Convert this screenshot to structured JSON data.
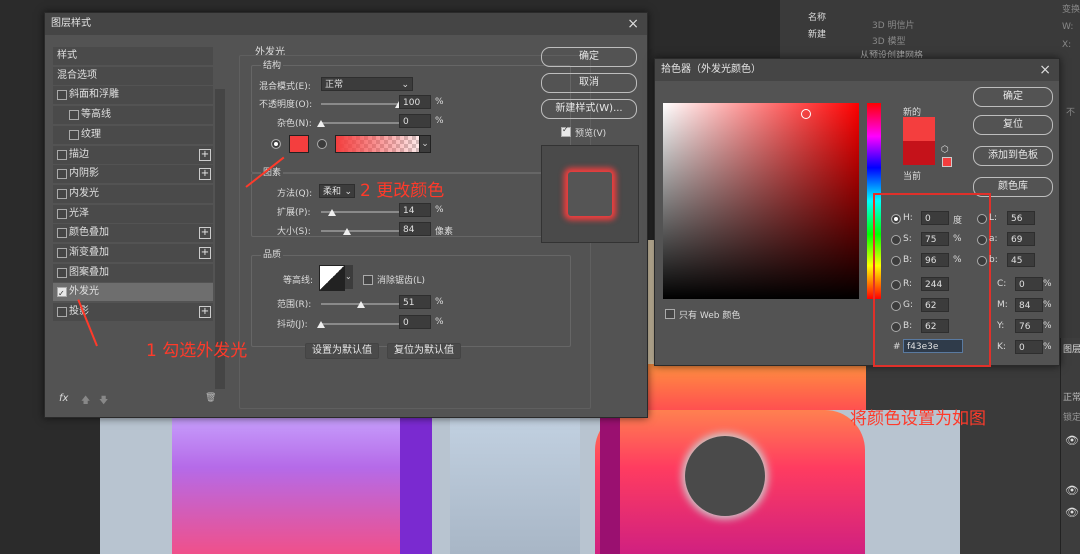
{
  "bg_panel": {
    "items": [
      "3D 明信片",
      "3D 模型",
      "从预设创建网格"
    ],
    "list": [
      "名称",
      "新建"
    ],
    "layers_label": "图层",
    "mode": "正常",
    "lock_label": "锁定",
    "right_labels": [
      "变换",
      "W:",
      "X:"
    ],
    "right_chars": [
      "不"
    ]
  },
  "layer_style": {
    "title": "图层样式",
    "close": "×",
    "side": [
      {
        "label": "样式",
        "check": false,
        "plus": false,
        "indent": 0
      },
      {
        "label": "混合选项",
        "check": false,
        "plus": false,
        "indent": 0
      },
      {
        "label": "斜面和浮雕",
        "check": true,
        "on": false,
        "plus": false,
        "indent": 0
      },
      {
        "label": "等高线",
        "check": true,
        "on": false,
        "plus": false,
        "indent": 1
      },
      {
        "label": "纹理",
        "check": true,
        "on": false,
        "plus": false,
        "indent": 1
      },
      {
        "label": "描边",
        "check": true,
        "on": false,
        "plus": true,
        "indent": 0
      },
      {
        "label": "内阴影",
        "check": true,
        "on": false,
        "plus": true,
        "indent": 0
      },
      {
        "label": "内发光",
        "check": true,
        "on": false,
        "plus": false,
        "indent": 0
      },
      {
        "label": "光泽",
        "check": true,
        "on": false,
        "plus": false,
        "indent": 0
      },
      {
        "label": "颜色叠加",
        "check": true,
        "on": false,
        "plus": true,
        "indent": 0
      },
      {
        "label": "渐变叠加",
        "check": true,
        "on": false,
        "plus": true,
        "indent": 0
      },
      {
        "label": "图案叠加",
        "check": true,
        "on": false,
        "plus": false,
        "indent": 0
      },
      {
        "label": "外发光",
        "check": true,
        "on": true,
        "plus": false,
        "indent": 0,
        "active": true
      },
      {
        "label": "投影",
        "check": true,
        "on": false,
        "plus": true,
        "indent": 0
      }
    ],
    "fx": "fx",
    "section_title": "外发光",
    "structure": "结构",
    "blend_mode_label": "混合模式(E):",
    "blend_mode_value": "正常",
    "opacity_label": "不透明度(O):",
    "opacity_value": "100",
    "opacity_pct": 1.0,
    "noise_label": "杂色(N):",
    "noise_value": "0",
    "noise_pct": 0.0,
    "percent": "%",
    "elements": "图素",
    "method_label": "方法(Q):",
    "method_value": "柔和",
    "spread_label": "扩展(P):",
    "spread_value": "14",
    "spread_pct": 0.14,
    "size_label": "大小(S):",
    "size_value": "84",
    "size_pct": 0.336,
    "px_unit": "像素",
    "quality": "品质",
    "contour_label": "等高线:",
    "antialias_label": "消除锯齿(L)",
    "range_label": "范围(R):",
    "range_value": "51",
    "range_pct": 0.51,
    "jitter_label": "抖动(J):",
    "jitter_value": "0",
    "jitter_pct": 0.0,
    "set_default": "设置为默认值",
    "reset_default": "复位为默认值",
    "ok": "确定",
    "cancel": "取消",
    "new_style": "新建样式(W)...",
    "preview": "预览(V)",
    "glow_color": "#f43e3e"
  },
  "annotations": {
    "step1": "1 勾选外发光",
    "step2": "2 更改颜色",
    "step3": "将颜色设置为如图"
  },
  "picker": {
    "title": "拾色器（外发光颜色）",
    "close": "×",
    "new_label": "新的",
    "current_label": "当前",
    "new_color": "#f43e3e",
    "current_color": "#c5121a",
    "ok": "确定",
    "reset": "复位",
    "add_swatch": "添加到色板",
    "libraries": "颜色库",
    "web_only": "只有 Web 颜色",
    "hsb": [
      {
        "label": "H:",
        "value": "0",
        "unit": "度",
        "selected": true
      },
      {
        "label": "S:",
        "value": "75",
        "unit": "%",
        "selected": false
      },
      {
        "label": "B:",
        "value": "96",
        "unit": "%",
        "selected": false
      }
    ],
    "rgb": [
      {
        "label": "R:",
        "value": "244"
      },
      {
        "label": "G:",
        "value": "62"
      },
      {
        "label": "B:",
        "value": "62"
      }
    ],
    "lab": [
      {
        "label": "L:",
        "value": "56"
      },
      {
        "label": "a:",
        "value": "69"
      },
      {
        "label": "b:",
        "value": "45"
      }
    ],
    "cmyk": [
      {
        "label": "C:",
        "value": "0"
      },
      {
        "label": "M:",
        "value": "84"
      },
      {
        "label": "Y:",
        "value": "76"
      },
      {
        "label": "K:",
        "value": "0"
      }
    ],
    "hash": "#",
    "hex": "f43e3e"
  }
}
